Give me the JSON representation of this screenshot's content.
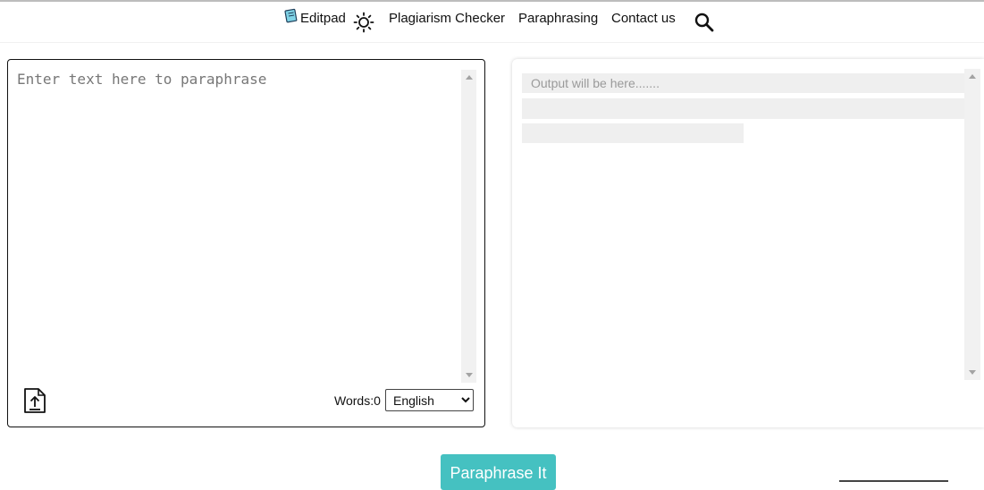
{
  "nav": {
    "brand": "Editpad",
    "links": [
      {
        "label": "Plagiarism Checker"
      },
      {
        "label": "Paraphrasing"
      },
      {
        "label": "Contact us"
      }
    ],
    "icons": {
      "brand": "notepad-icon",
      "theme": "sun-icon",
      "search": "search-icon"
    }
  },
  "input": {
    "placeholder": "Enter text here to paraphrase",
    "value": "",
    "words_label": "Words:",
    "words_count": "0",
    "language": {
      "selected": "English",
      "options": [
        "English"
      ]
    }
  },
  "output": {
    "placeholder": "Output will be here......."
  },
  "actions": {
    "paraphrase_label": "Paraphrase It"
  },
  "colors": {
    "accent": "#45c1c1",
    "skeleton": "#efefef",
    "border": "#111111"
  }
}
